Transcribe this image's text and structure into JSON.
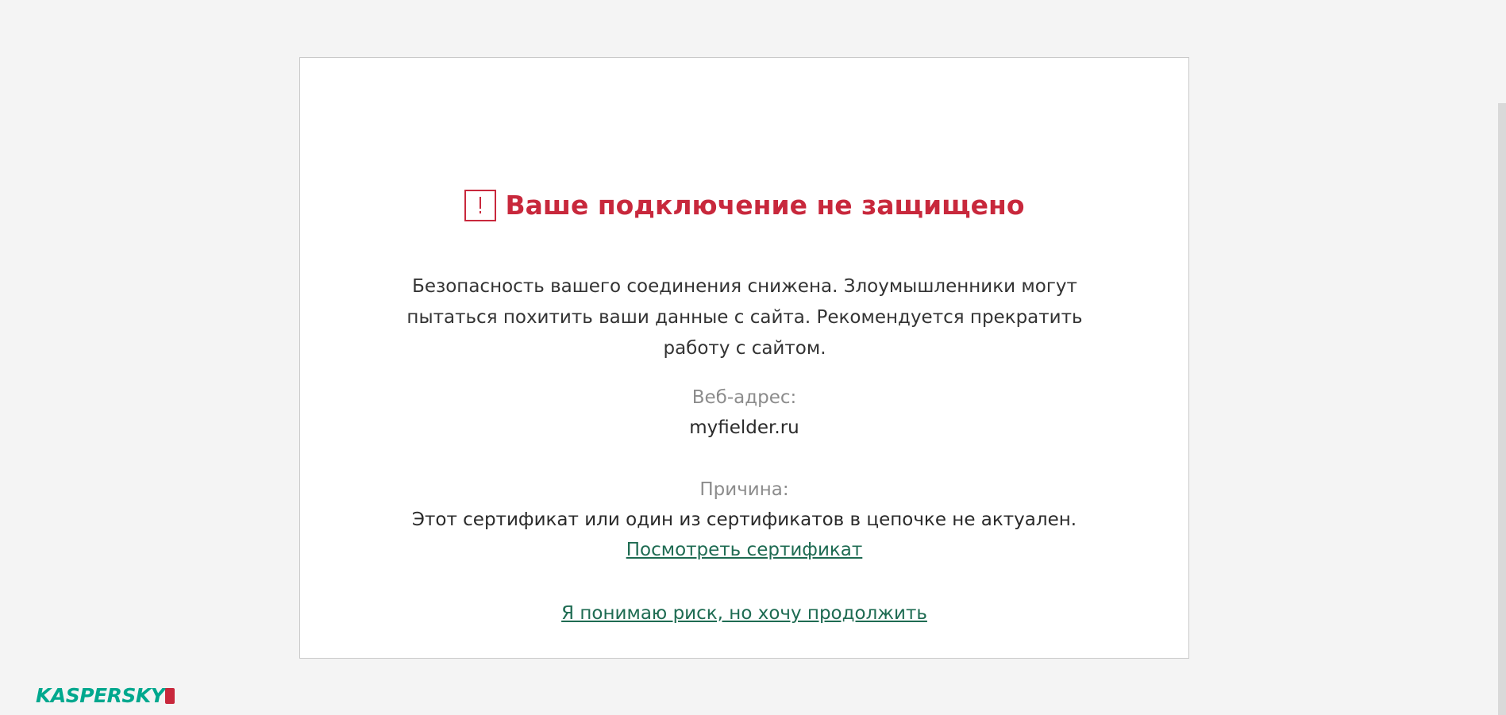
{
  "dialog": {
    "title": "Ваше подключение не защищено",
    "description": "Безопасность вашего соединения снижена. Злоумышленники могут пытаться похитить ваши данные с сайта. Рекомендуется прекратить работу с сайтом.",
    "web_address_label": "Веб-адрес:",
    "web_address_value": "myfielder.ru",
    "reason_label": "Причина:",
    "reason_value": "Этот сертификат или один из сертификатов в цепочке не актуален.",
    "view_certificate_link": "Посмотреть сертификат",
    "proceed_link": "Я понимаю риск, но хочу продолжить"
  },
  "brand": {
    "logo_text": "KASPERSKY",
    "logo_badge": "lab"
  },
  "colors": {
    "alert_red": "#c8283c",
    "link_green": "#1e6b52",
    "brand_teal": "#00a88e",
    "background": "#f4f4f4"
  },
  "icons": {
    "warning": "exclamation-box-icon"
  }
}
